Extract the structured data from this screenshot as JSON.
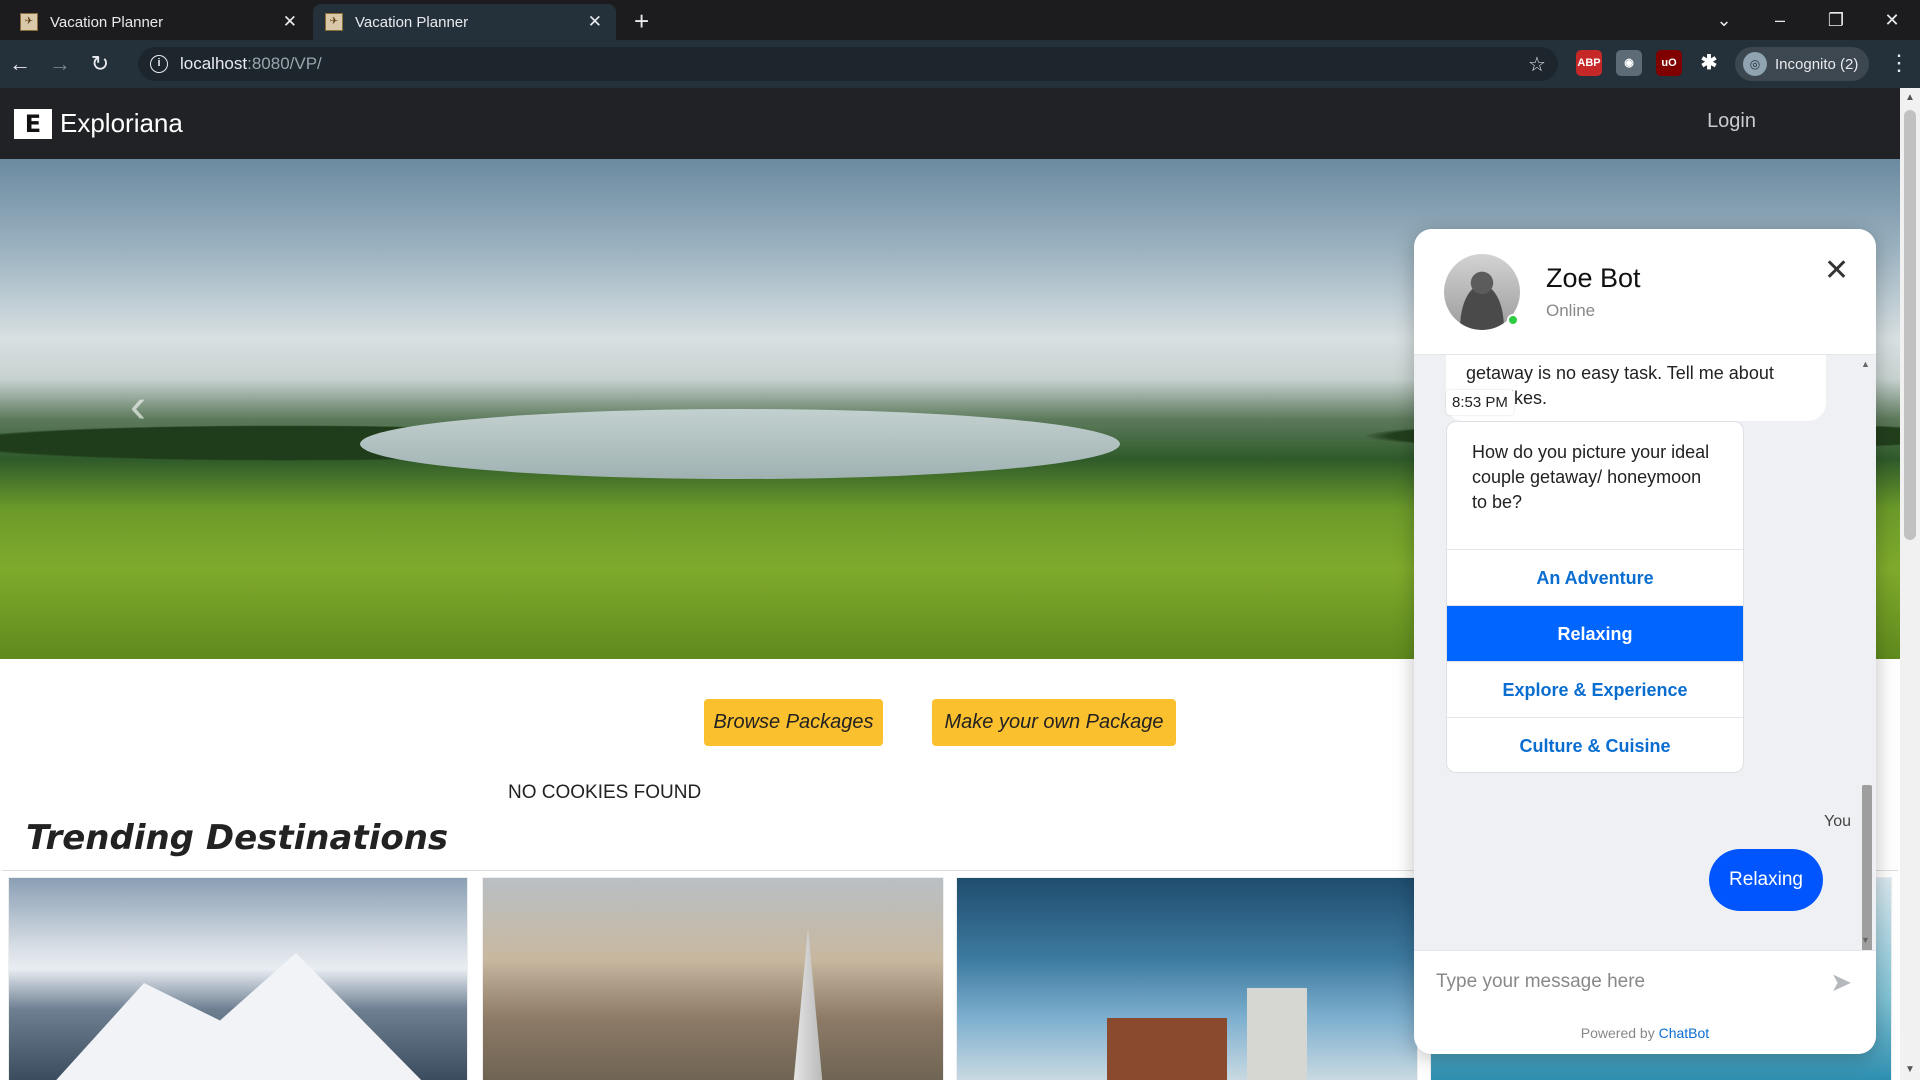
{
  "browser": {
    "tabs": [
      {
        "title": "Vacation Planner",
        "active": false
      },
      {
        "title": "Vacation Planner",
        "active": true
      }
    ],
    "url_host": "localhost",
    "url_path": ":8080/VP/",
    "profile_label": "Incognito (2)",
    "extension_icons": [
      "adblock-icon",
      "camera-icon",
      "ublock-icon",
      "extensions-puzzle-icon"
    ]
  },
  "site": {
    "brand_letter": "E",
    "brand_name": "Exploriana",
    "login_label": "Login"
  },
  "actions": {
    "browse_label": "Browse Packages",
    "make_label": "Make your own Package"
  },
  "cookies_text": "NO COOKIES FOUND",
  "trending_title": "Trending Destinations",
  "chat": {
    "bot_name": "Zoe Bot",
    "status": "Online",
    "partial_message": "getaway is no easy task. Tell me about your likes.",
    "timestamp": "8:53 PM",
    "question": "How do you picture your ideal couple getaway/ honeymoon to be?",
    "options": [
      {
        "label": "An Adventure",
        "selected": false
      },
      {
        "label": "Relaxing",
        "selected": true
      },
      {
        "label": "Explore & Experience",
        "selected": false
      },
      {
        "label": "Culture & Cuisine",
        "selected": false
      }
    ],
    "user_label": "You",
    "user_message": "Relaxing",
    "input_placeholder": "Type your message here",
    "powered_prefix": "Powered by",
    "powered_brand": "ChatBot"
  },
  "colors": {
    "accent_yellow": "#fbc02d",
    "chat_blue": "#0066ff",
    "navbar": "#202226"
  }
}
